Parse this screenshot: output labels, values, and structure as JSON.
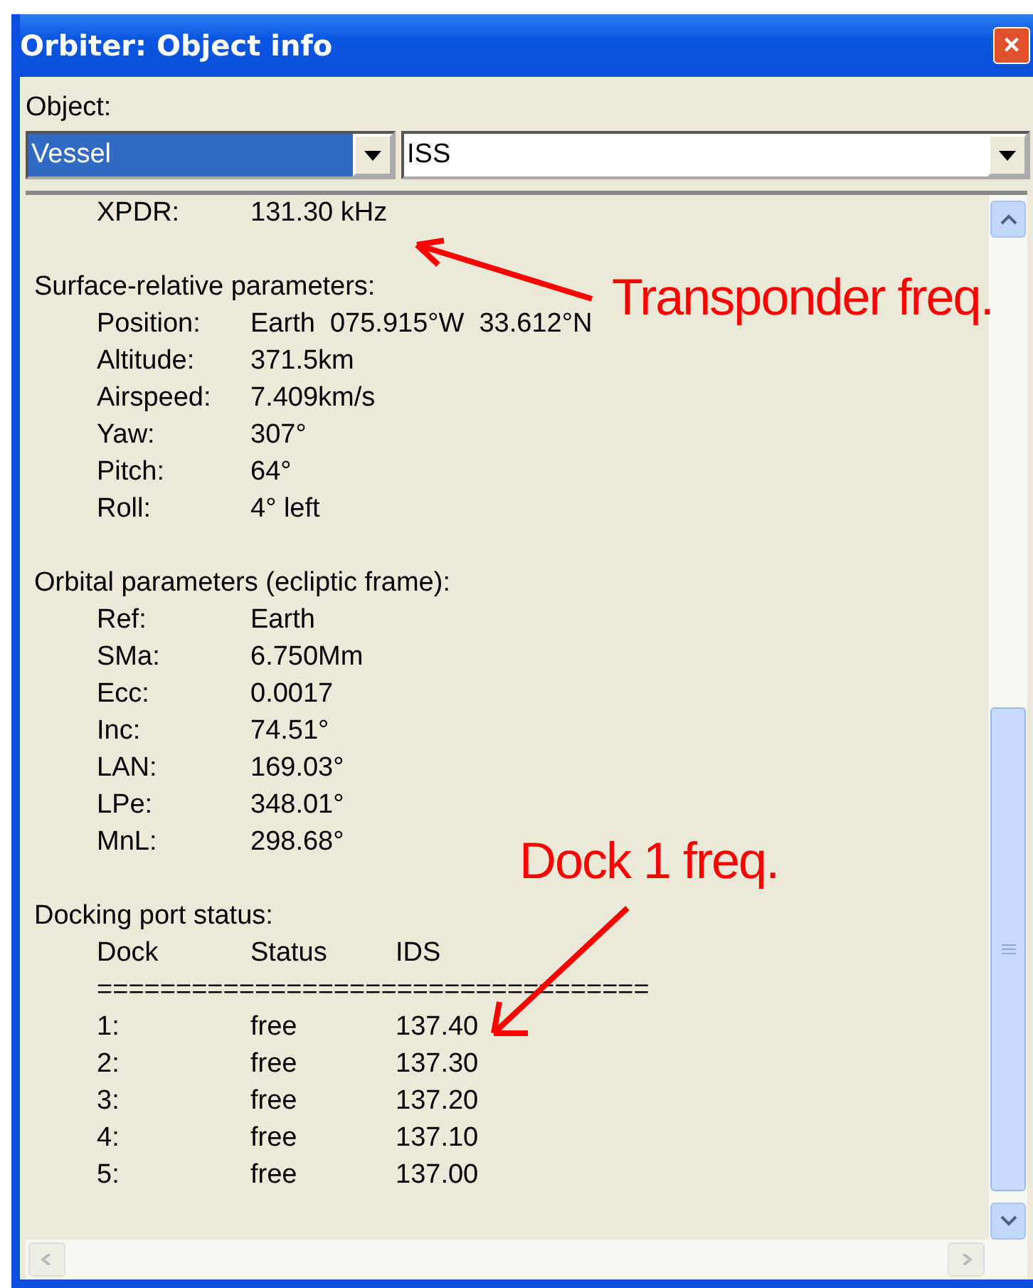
{
  "window": {
    "title": "Orbiter: Object info",
    "close": "×"
  },
  "object": {
    "label": "Object:",
    "type_value": "Vessel",
    "name_value": "ISS"
  },
  "info": {
    "top_rows": [
      {
        "label": "XPDR:",
        "value": "131.30 kHz"
      }
    ],
    "sections": [
      {
        "heading": "Surface-relative parameters:",
        "rows": [
          {
            "label": "Position:",
            "value": "Earth  075.915°W  33.612°N"
          },
          {
            "label": "Altitude:",
            "value": "371.5km"
          },
          {
            "label": "Airspeed:",
            "value": "7.409km/s"
          },
          {
            "label": "Yaw:",
            "value": "307°"
          },
          {
            "label": "Pitch:",
            "value": "64°"
          },
          {
            "label": "Roll:",
            "value": "4° left"
          }
        ]
      },
      {
        "heading": "Orbital parameters (ecliptic frame):",
        "rows": [
          {
            "label": "Ref:",
            "value": "Earth"
          },
          {
            "label": "SMa:",
            "value": "6.750Mm"
          },
          {
            "label": "Ecc:",
            "value": "0.0017"
          },
          {
            "label": "Inc:",
            "value": "74.51°"
          },
          {
            "label": "LAN:",
            "value": "169.03°"
          },
          {
            "label": "LPe:",
            "value": "348.01°"
          },
          {
            "label": "MnL:",
            "value": "298.68°"
          }
        ]
      }
    ],
    "docking": {
      "heading": "Docking port status:",
      "columns": [
        "Dock",
        "Status",
        "IDS"
      ],
      "separator": "===================================",
      "rows": [
        [
          "1:",
          "free",
          "137.40"
        ],
        [
          "2:",
          "free",
          "137.30"
        ],
        [
          "3:",
          "free",
          "137.20"
        ],
        [
          "4:",
          "free",
          "137.10"
        ],
        [
          "5:",
          "free",
          "137.00"
        ]
      ]
    }
  },
  "annotations": [
    {
      "text": "Transponder freq."
    },
    {
      "text": "Dock 1 freq."
    }
  ]
}
